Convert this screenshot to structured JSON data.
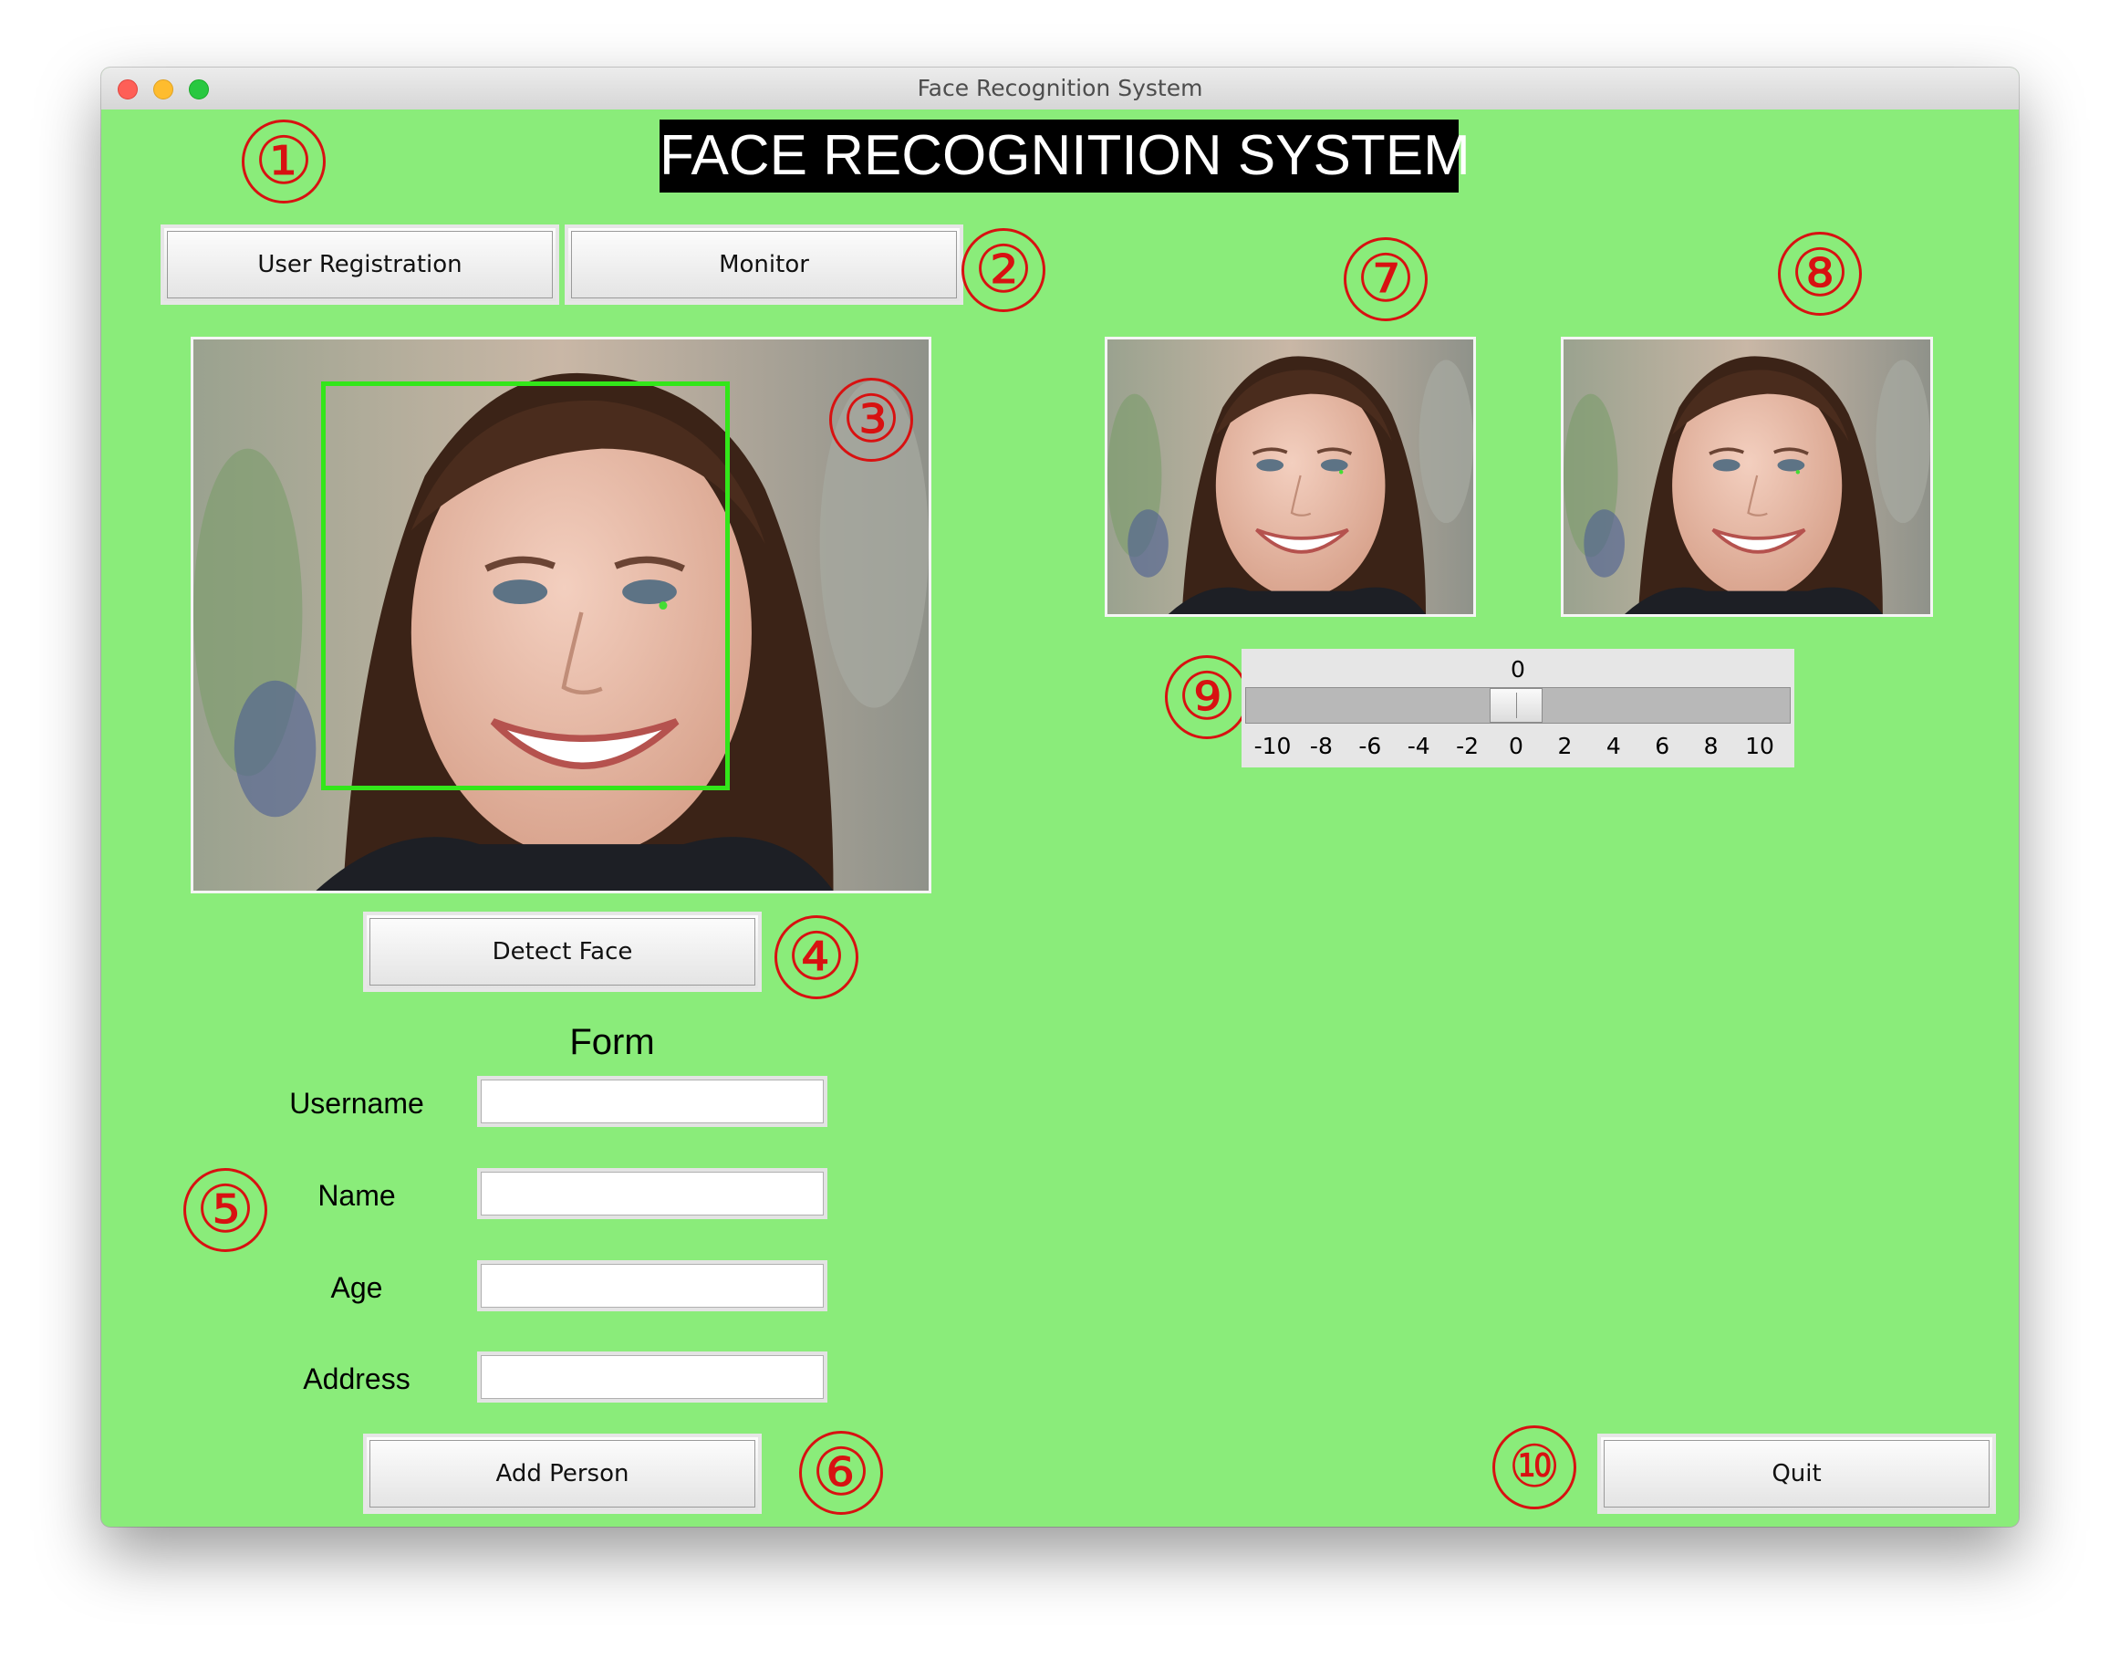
{
  "window": {
    "title": "Face Recognition System"
  },
  "header": {
    "title": "FACE RECOGNITION SYSTEM"
  },
  "nav": {
    "user_registration_label": "User Registration",
    "monitor_label": "Monitor"
  },
  "camera": {
    "detect_face_label": "Detect Face"
  },
  "form": {
    "title": "Form",
    "fields": [
      {
        "label": "Username",
        "value": ""
      },
      {
        "label": "Name",
        "value": ""
      },
      {
        "label": "Age",
        "value": ""
      },
      {
        "label": "Address",
        "value": ""
      }
    ],
    "add_person_label": "Add Person"
  },
  "slider": {
    "value": 0,
    "value_label": "0",
    "min": -10,
    "max": 10,
    "ticks": [
      "-10",
      "-8",
      "-6",
      "-4",
      "-2",
      "0",
      "2",
      "4",
      "6",
      "8",
      "10"
    ]
  },
  "footer": {
    "quit_label": "Quit"
  },
  "markers": [
    "①",
    "②",
    "③",
    "④",
    "⑤",
    "⑥",
    "⑦",
    "⑧",
    "⑨",
    "⑩"
  ],
  "colors": {
    "background": "#8aec7a",
    "marker": "#d81111",
    "face_box": "#33e61a",
    "header_bg": "#000000",
    "header_text": "#ffffff"
  }
}
